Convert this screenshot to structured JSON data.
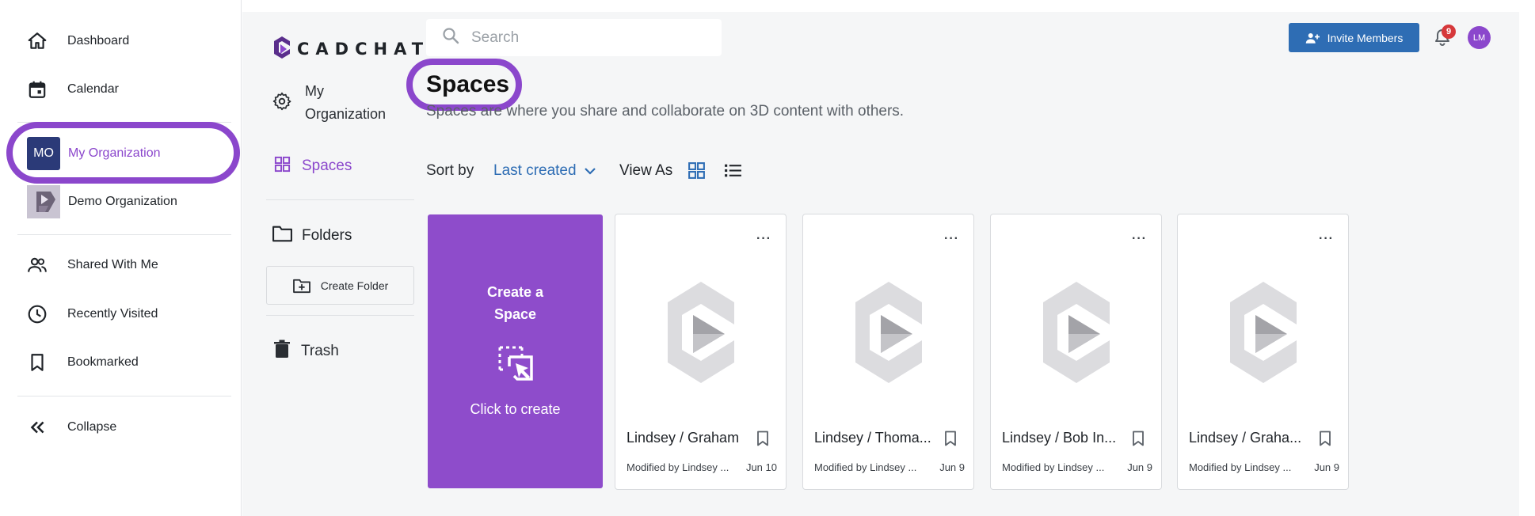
{
  "sidebar": {
    "items": [
      {
        "label": "Dashboard",
        "icon": "home-icon"
      },
      {
        "label": "Calendar",
        "icon": "calendar-icon"
      }
    ],
    "organizations": [
      {
        "label": "My Organization",
        "initials": "MO",
        "selected": true
      },
      {
        "label": "Demo Organization",
        "initials": ""
      }
    ],
    "links": [
      {
        "label": "Shared With Me",
        "icon": "people-icon"
      },
      {
        "label": "Recently Visited",
        "icon": "clock-icon"
      },
      {
        "label": "Bookmarked",
        "icon": "bookmark-icon"
      }
    ],
    "collapse_label": "Collapse"
  },
  "brand": {
    "name": "CADCHAT"
  },
  "subnav": {
    "org_settings_label": "My Organization",
    "spaces_label": "Spaces",
    "folders_label": "Folders",
    "create_folder_label": "Create Folder",
    "trash_label": "Trash"
  },
  "search": {
    "placeholder": "Search",
    "value": ""
  },
  "header": {
    "invite_label": "Invite Members",
    "notification_count": "9",
    "user_initials": "LM"
  },
  "page": {
    "title": "Spaces",
    "subtitle": "Spaces are where you share and collaborate on 3D content with others."
  },
  "toolbar": {
    "sort_label": "Sort by",
    "sort_value": "Last created",
    "view_label": "View As"
  },
  "create_card": {
    "title": "Create a Space",
    "subtitle": "Click to create"
  },
  "spaces": [
    {
      "name": "Lindsey / Graham",
      "modified": "Modified by Lindsey ...",
      "date": "Jun 10"
    },
    {
      "name": "Lindsey / Thoma...",
      "modified": "Modified by Lindsey ...",
      "date": "Jun 9"
    },
    {
      "name": "Lindsey / Bob In...",
      "modified": "Modified by Lindsey ...",
      "date": "Jun 9"
    },
    {
      "name": "Lindsey / Graha...",
      "modified": "Modified by Lindsey ...",
      "date": "Jun 9"
    }
  ],
  "colors": {
    "accent_purple": "#8b47cc",
    "primary_blue": "#2e6db4",
    "notification_red": "#d6383b",
    "org_avatar_navy": "#2b3a78"
  }
}
